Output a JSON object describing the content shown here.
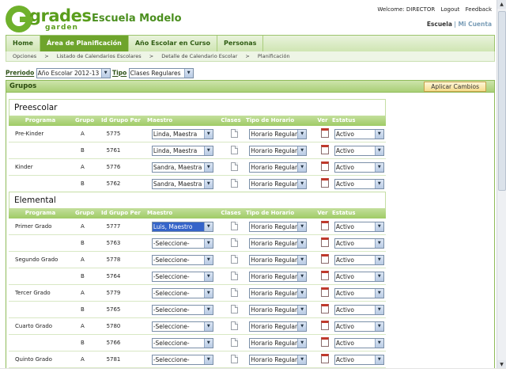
{
  "brand": {
    "logo_word": "grades",
    "logo_sub": "garden",
    "school": "Escuela Modelo"
  },
  "toplinks": {
    "welcome": "Welcome: DIRECTOR",
    "logout": "Logout",
    "feedback": "Feedback"
  },
  "userlinks": {
    "school": "Escuela",
    "separator": "|",
    "account": "Mi Cuenta"
  },
  "tabs": [
    {
      "label": "Home"
    },
    {
      "label": "Área de Planificación"
    },
    {
      "label": "Año Escolar en Curso"
    },
    {
      "label": "Personas"
    }
  ],
  "breadcrumb": [
    "Opciones",
    ">",
    "Listado de Calendarios Escolares",
    ">",
    "Detalle de Calendario Escolar",
    ">",
    "Planificación"
  ],
  "filter": {
    "periodo_label": "Preriodo",
    "periodo_value": "Año Escolar 2012-13",
    "tipo_label": "Tipo",
    "tipo_value": "Clases Regulares"
  },
  "groups": {
    "title": "Grupos",
    "apply_label": "Aplicar Cambios"
  },
  "columns": [
    "Programa",
    "Grupo",
    "Id Grupo Per",
    "Maestro",
    "Clases",
    "Tipo de Horario",
    "Ver",
    "Estatus"
  ],
  "sections": [
    {
      "title": "Preescolar",
      "rows": [
        {
          "programa": "Pre-Kinder",
          "grupo": "A",
          "id": "5775",
          "maestro": "Linda, Maestra",
          "horario": "Horario Regular",
          "estatus": "Activo"
        },
        {
          "programa": "",
          "grupo": "B",
          "id": "5761",
          "maestro": "Linda, Maestra",
          "horario": "Horario Regular",
          "estatus": "Activo"
        },
        {
          "programa": "Kinder",
          "grupo": "A",
          "id": "5776",
          "maestro": "Sandra, Maestra",
          "horario": "Horario Regular",
          "estatus": "Activo"
        },
        {
          "programa": "",
          "grupo": "B",
          "id": "5762",
          "maestro": "Sandra, Maestra",
          "horario": "Horario Regular",
          "estatus": "Activo"
        }
      ]
    },
    {
      "title": "Elemental",
      "rows": [
        {
          "programa": "Primer Grado",
          "grupo": "A",
          "id": "5777",
          "maestro": "Luis, Maestro",
          "horario": "Horario Regular",
          "estatus": "Activo"
        },
        {
          "programa": "",
          "grupo": "B",
          "id": "5763",
          "maestro": "-Seleccione-",
          "horario": "Horario Regular",
          "estatus": "Activo"
        },
        {
          "programa": "Segundo Grado",
          "grupo": "A",
          "id": "5778",
          "maestro": "-Seleccione-",
          "horario": "Horario Regular",
          "estatus": "Activo"
        },
        {
          "programa": "",
          "grupo": "B",
          "id": "5764",
          "maestro": "-Seleccione-",
          "horario": "Horario Regular",
          "estatus": "Activo"
        },
        {
          "programa": "Tercer Grado",
          "grupo": "A",
          "id": "5779",
          "maestro": "-Seleccione-",
          "horario": "Horario Regular",
          "estatus": "Activo"
        },
        {
          "programa": "",
          "grupo": "B",
          "id": "5765",
          "maestro": "-Seleccione-",
          "horario": "Horario Regular",
          "estatus": "Activo"
        },
        {
          "programa": "Cuarto Grado",
          "grupo": "A",
          "id": "5780",
          "maestro": "-Seleccione-",
          "horario": "Horario Regular",
          "estatus": "Activo"
        },
        {
          "programa": "",
          "grupo": "B",
          "id": "5766",
          "maestro": "-Seleccione-",
          "horario": "Horario Regular",
          "estatus": "Activo"
        },
        {
          "programa": "Quinto Grado",
          "grupo": "A",
          "id": "5781",
          "maestro": "-Seleccione-",
          "horario": "Horario Regular",
          "estatus": "Activo"
        }
      ]
    }
  ],
  "colors": {
    "accent_green": "#6ea42c",
    "header_green": "#a9cf76",
    "brand_green": "#5a9e1c",
    "selected_blue": "#3564c9"
  }
}
